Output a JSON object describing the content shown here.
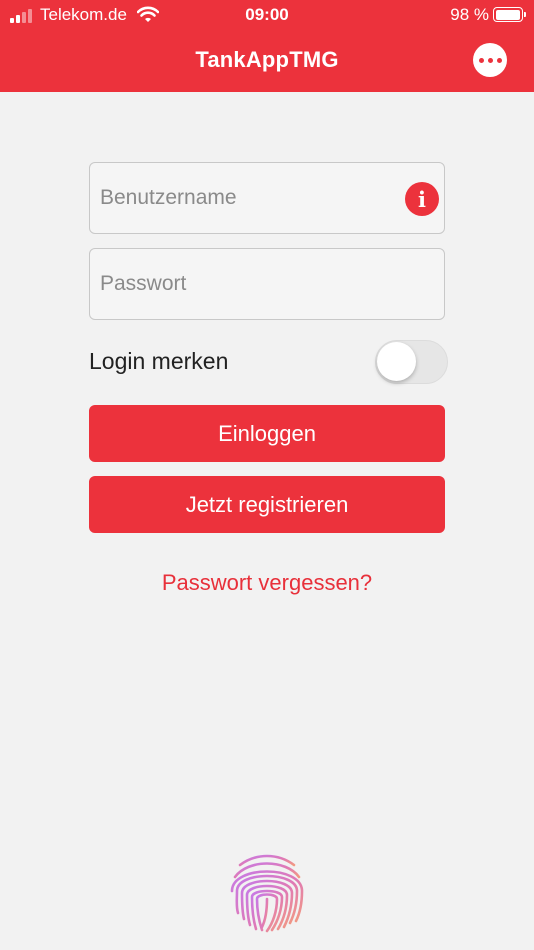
{
  "status_bar": {
    "carrier": "Telekom.de",
    "time": "09:00",
    "battery_percent": "98 %",
    "battery_level": 0.98,
    "icons": [
      "signal-icon",
      "wifi-icon",
      "battery-icon"
    ]
  },
  "nav": {
    "title": "TankAppTMG",
    "more_icon": "more-horizontal-icon"
  },
  "login_form": {
    "username": {
      "placeholder": "Benutzername",
      "value": "",
      "info_icon": "info-icon",
      "info_glyph": "i"
    },
    "password": {
      "placeholder": "Passwort",
      "value": ""
    },
    "remember": {
      "label": "Login merken",
      "checked": false
    },
    "login_button": "Einloggen",
    "register_button": "Jetzt registrieren",
    "forgot_link": "Passwort vergessen?"
  },
  "biometric": {
    "icon": "fingerprint-icon"
  },
  "colors": {
    "accent": "#ec323c",
    "background": "#f2f2f2",
    "field_border": "#c8c8c8",
    "toggle_off": "#e6e6e6"
  }
}
